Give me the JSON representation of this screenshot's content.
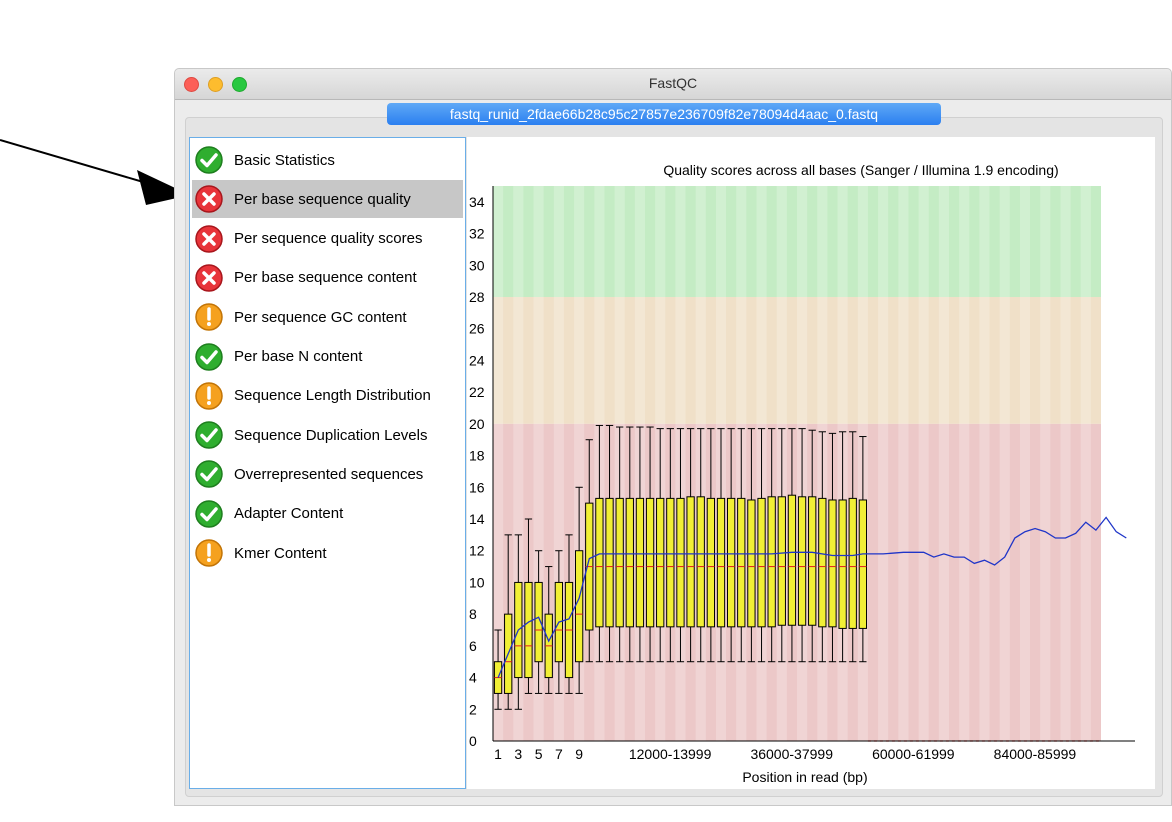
{
  "window": {
    "title": "FastQC",
    "tab_label": "fastq_runid_2fdae66b28c95c27857e236709f82e78094d4aac_0.fastq"
  },
  "modules": [
    {
      "label": "Basic Statistics",
      "status": "pass",
      "selected": false
    },
    {
      "label": "Per base sequence quality",
      "status": "fail",
      "selected": true
    },
    {
      "label": "Per sequence quality scores",
      "status": "fail",
      "selected": false
    },
    {
      "label": "Per base sequence content",
      "status": "fail",
      "selected": false
    },
    {
      "label": "Per sequence GC content",
      "status": "warn",
      "selected": false
    },
    {
      "label": "Per base N content",
      "status": "pass",
      "selected": false
    },
    {
      "label": "Sequence Length Distribution",
      "status": "warn",
      "selected": false
    },
    {
      "label": "Sequence Duplication Levels",
      "status": "pass",
      "selected": false
    },
    {
      "label": "Overrepresented sequences",
      "status": "pass",
      "selected": false
    },
    {
      "label": "Adapter Content",
      "status": "pass",
      "selected": false
    },
    {
      "label": "Kmer Content",
      "status": "warn",
      "selected": false
    }
  ],
  "icons": {
    "pass": "check-icon",
    "fail": "cross-icon",
    "warn": "exclamation-icon"
  },
  "colors": {
    "pass": "#2fae2f",
    "fail": "#e8343a",
    "warn": "#f5a11f",
    "zone_good": "#c4ecc4",
    "zone_ok": "#f0e0c8",
    "zone_bad": "#ecc8c8",
    "box_fill": "#f1ef36",
    "mean_line": "#1f35c8",
    "median_line": "#e02020"
  },
  "chart_data": {
    "type": "boxplot",
    "title": "Quality scores across all bases (Sanger / Illumina 1.9 encoding)",
    "xlabel": "Position in read (bp)",
    "ylim": [
      0,
      35
    ],
    "yticks": [
      "0",
      "2",
      "4",
      "6",
      "8",
      "10",
      "12",
      "14",
      "16",
      "18",
      "20",
      "22",
      "24",
      "26",
      "28",
      "30",
      "32",
      "34"
    ],
    "xtick_labels": [
      "1",
      "3",
      "5",
      "7",
      "9",
      "12000-13999",
      "36000-37999",
      "60000-61999",
      "84000-85999"
    ],
    "xtick_groups": [
      0,
      2,
      4,
      6,
      8,
      14,
      26,
      38,
      50
    ],
    "zones": [
      {
        "name": "good",
        "from": 28,
        "to": 35
      },
      {
        "name": "ok",
        "from": 20,
        "to": 28
      },
      {
        "name": "bad",
        "from": 0,
        "to": 20
      }
    ],
    "groups": 60,
    "boxes": [
      {
        "lw": 2,
        "q1": 3,
        "med": 4,
        "q3": 5,
        "uw": 7
      },
      {
        "lw": 2,
        "q1": 3,
        "med": 5,
        "q3": 8,
        "uw": 13
      },
      {
        "lw": 2,
        "q1": 4,
        "med": 6,
        "q3": 10,
        "uw": 13
      },
      {
        "lw": 3,
        "q1": 4,
        "med": 6,
        "q3": 10,
        "uw": 14
      },
      {
        "lw": 3,
        "q1": 5,
        "med": 7,
        "q3": 10,
        "uw": 12
      },
      {
        "lw": 3,
        "q1": 4,
        "med": 6,
        "q3": 8,
        "uw": 11
      },
      {
        "lw": 3,
        "q1": 5,
        "med": 7,
        "q3": 10,
        "uw": 12
      },
      {
        "lw": 3,
        "q1": 4,
        "med": 7,
        "q3": 10,
        "uw": 13
      },
      {
        "lw": 3,
        "q1": 5,
        "med": 8,
        "q3": 12,
        "uw": 16
      },
      {
        "lw": 5,
        "q1": 7,
        "med": 11,
        "q3": 15,
        "uw": 19
      },
      {
        "lw": 5,
        "q1": 7.2,
        "med": 11,
        "q3": 15.3,
        "uw": 19.9
      },
      {
        "lw": 5,
        "q1": 7.2,
        "med": 11,
        "q3": 15.3,
        "uw": 19.9
      },
      {
        "lw": 5,
        "q1": 7.2,
        "med": 11,
        "q3": 15.3,
        "uw": 19.8
      },
      {
        "lw": 5,
        "q1": 7.2,
        "med": 11,
        "q3": 15.3,
        "uw": 19.8
      },
      {
        "lw": 5,
        "q1": 7.2,
        "med": 11,
        "q3": 15.3,
        "uw": 19.8
      },
      {
        "lw": 5,
        "q1": 7.2,
        "med": 11,
        "q3": 15.3,
        "uw": 19.8
      },
      {
        "lw": 5,
        "q1": 7.2,
        "med": 11,
        "q3": 15.3,
        "uw": 19.7
      },
      {
        "lw": 5,
        "q1": 7.2,
        "med": 11,
        "q3": 15.3,
        "uw": 19.7
      },
      {
        "lw": 5,
        "q1": 7.2,
        "med": 11,
        "q3": 15.3,
        "uw": 19.7
      },
      {
        "lw": 5,
        "q1": 7.2,
        "med": 11,
        "q3": 15.4,
        "uw": 19.7
      },
      {
        "lw": 5,
        "q1": 7.2,
        "med": 11,
        "q3": 15.4,
        "uw": 19.7
      },
      {
        "lw": 5,
        "q1": 7.2,
        "med": 11,
        "q3": 15.3,
        "uw": 19.7
      },
      {
        "lw": 5,
        "q1": 7.2,
        "med": 11,
        "q3": 15.3,
        "uw": 19.7
      },
      {
        "lw": 5,
        "q1": 7.2,
        "med": 11,
        "q3": 15.3,
        "uw": 19.7
      },
      {
        "lw": 5,
        "q1": 7.2,
        "med": 11,
        "q3": 15.3,
        "uw": 19.7
      },
      {
        "lw": 5,
        "q1": 7.2,
        "med": 11,
        "q3": 15.2,
        "uw": 19.7
      },
      {
        "lw": 5,
        "q1": 7.2,
        "med": 11,
        "q3": 15.3,
        "uw": 19.7
      },
      {
        "lw": 5,
        "q1": 7.2,
        "med": 11,
        "q3": 15.4,
        "uw": 19.7
      },
      {
        "lw": 5,
        "q1": 7.3,
        "med": 11,
        "q3": 15.4,
        "uw": 19.7
      },
      {
        "lw": 5,
        "q1": 7.3,
        "med": 11,
        "q3": 15.5,
        "uw": 19.7
      },
      {
        "lw": 5,
        "q1": 7.3,
        "med": 11,
        "q3": 15.4,
        "uw": 19.7
      },
      {
        "lw": 5,
        "q1": 7.3,
        "med": 11,
        "q3": 15.4,
        "uw": 19.6
      },
      {
        "lw": 5,
        "q1": 7.2,
        "med": 11,
        "q3": 15.3,
        "uw": 19.5
      },
      {
        "lw": 5,
        "q1": 7.2,
        "med": 11,
        "q3": 15.2,
        "uw": 19.4
      },
      {
        "lw": 5,
        "q1": 7.1,
        "med": 11,
        "q3": 15.2,
        "uw": 19.5
      },
      {
        "lw": 5,
        "q1": 7.1,
        "med": 11,
        "q3": 15.3,
        "uw": 19.5
      },
      {
        "lw": 5,
        "q1": 7.1,
        "med": 11,
        "q3": 15.2,
        "uw": 19.2
      }
    ],
    "mean_line": [
      {
        "x": 1,
        "y": 4
      },
      {
        "x": 2,
        "y": 5.5
      },
      {
        "x": 3,
        "y": 7
      },
      {
        "x": 4,
        "y": 7.5
      },
      {
        "x": 5,
        "y": 7.8
      },
      {
        "x": 6,
        "y": 6.3
      },
      {
        "x": 7,
        "y": 7.5
      },
      {
        "x": 8,
        "y": 7.7
      },
      {
        "x": 9,
        "y": 9
      },
      {
        "x": 10,
        "y": 11.5
      },
      {
        "x": 11,
        "y": 11.8
      },
      {
        "x": 12,
        "y": 11.8
      },
      {
        "x": 14,
        "y": 11.8
      },
      {
        "x": 16,
        "y": 11.8
      },
      {
        "x": 18,
        "y": 11.8
      },
      {
        "x": 20,
        "y": 11.8
      },
      {
        "x": 22,
        "y": 11.8
      },
      {
        "x": 24,
        "y": 11.8
      },
      {
        "x": 26,
        "y": 11.8
      },
      {
        "x": 28,
        "y": 11.8
      },
      {
        "x": 30,
        "y": 11.9
      },
      {
        "x": 32,
        "y": 11.9
      },
      {
        "x": 34,
        "y": 11.7
      },
      {
        "x": 36,
        "y": 11.7
      },
      {
        "x": 37,
        "y": 11.8
      },
      {
        "x": 39,
        "y": 11.8
      },
      {
        "x": 41,
        "y": 11.9
      },
      {
        "x": 42,
        "y": 11.9
      },
      {
        "x": 43,
        "y": 11.9
      },
      {
        "x": 44,
        "y": 11.6
      },
      {
        "x": 45,
        "y": 11.8
      },
      {
        "x": 46,
        "y": 11.6
      },
      {
        "x": 47,
        "y": 11.6
      },
      {
        "x": 48,
        "y": 11.2
      },
      {
        "x": 49,
        "y": 11.4
      },
      {
        "x": 50,
        "y": 11.1
      },
      {
        "x": 51,
        "y": 11.6
      },
      {
        "x": 52,
        "y": 12.8
      },
      {
        "x": 53,
        "y": 13.2
      },
      {
        "x": 54,
        "y": 13.4
      },
      {
        "x": 55,
        "y": 13.2
      },
      {
        "x": 56,
        "y": 12.8
      },
      {
        "x": 57,
        "y": 12.8
      },
      {
        "x": 58,
        "y": 13.1
      },
      {
        "x": 59,
        "y": 13.8
      },
      {
        "x": 60,
        "y": 13.3
      },
      {
        "x": 61,
        "y": 14.1
      },
      {
        "x": 62,
        "y": 13.2
      },
      {
        "x": 63,
        "y": 12.8
      }
    ]
  }
}
